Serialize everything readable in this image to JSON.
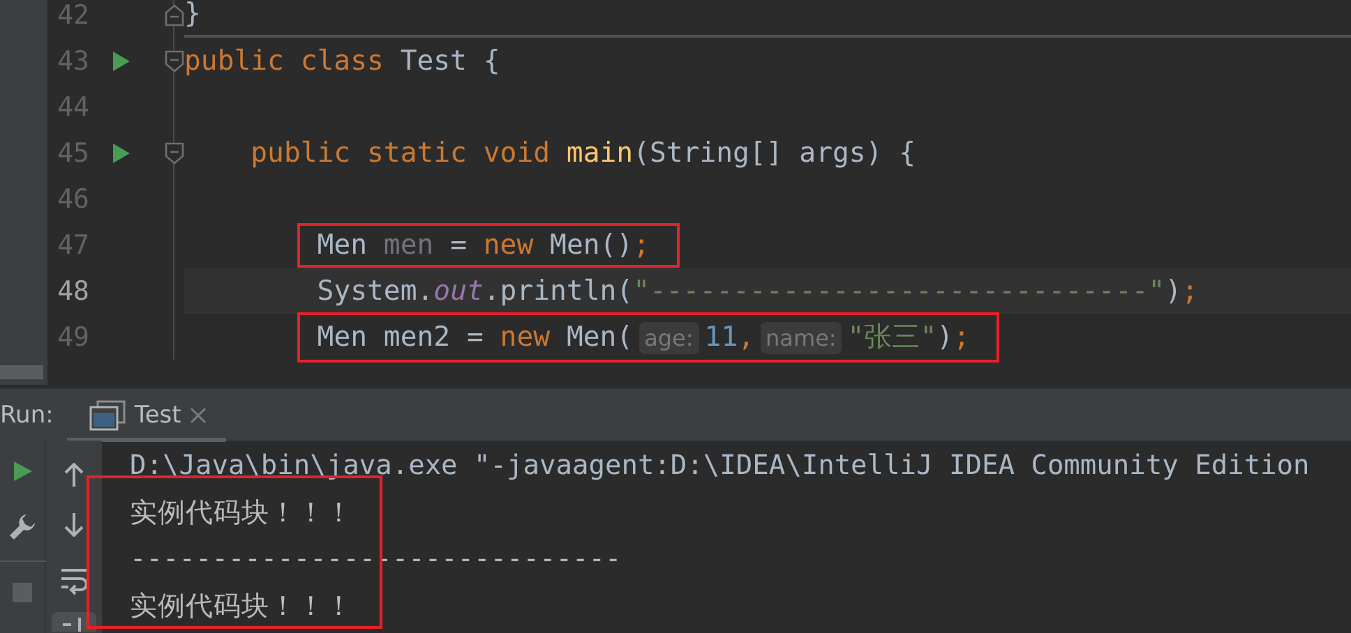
{
  "editor": {
    "lines": [
      {
        "number": "42",
        "current": false,
        "run_icon": false,
        "fold_start": false,
        "fold_end": true,
        "separator": true,
        "annotated": false,
        "tokens": [
          {
            "kind": "plain",
            "text": "}"
          }
        ]
      },
      {
        "number": "43",
        "current": false,
        "run_icon": true,
        "fold_start": true,
        "fold_end": false,
        "separator": false,
        "annotated": false,
        "tokens": [
          {
            "kind": "keyword",
            "text": "public class "
          },
          {
            "kind": "plain",
            "text": "Test {"
          }
        ]
      },
      {
        "number": "44",
        "current": false,
        "run_icon": false,
        "fold_start": false,
        "fold_end": false,
        "separator": false,
        "annotated": false
      },
      {
        "number": "45",
        "current": false,
        "run_icon": true,
        "fold_start": true,
        "fold_end": false,
        "separator": false,
        "annotated": false,
        "tokens": [
          {
            "kind": "keyword",
            "text": "    public static void "
          },
          {
            "kind": "method",
            "text": "main"
          },
          {
            "kind": "plain",
            "text": "(String[] args) {"
          }
        ]
      },
      {
        "number": "46",
        "current": false,
        "run_icon": false,
        "fold_start": false,
        "fold_end": false,
        "separator": false,
        "annotated": false
      },
      {
        "number": "47",
        "current": false,
        "run_icon": false,
        "fold_start": false,
        "fold_end": false,
        "separator": false,
        "annotated": true,
        "tokens": [
          {
            "kind": "plain",
            "text": "        Men "
          },
          {
            "kind": "unused",
            "text": "men"
          },
          {
            "kind": "plain",
            "text": " = "
          },
          {
            "kind": "keyword",
            "text": "new "
          },
          {
            "kind": "plain",
            "text": "Men()"
          },
          {
            "kind": "keyword",
            "text": ";"
          }
        ]
      },
      {
        "number": "48",
        "current": true,
        "run_icon": false,
        "fold_start": false,
        "fold_end": false,
        "separator": false,
        "annotated": false,
        "tokens": [
          {
            "kind": "plain",
            "text": "        System."
          },
          {
            "kind": "static",
            "text": "out"
          },
          {
            "kind": "plain",
            "text": ".println("
          },
          {
            "kind": "string",
            "text": "\"------------------------------\""
          },
          {
            "kind": "plain",
            "text": ")"
          },
          {
            "kind": "keyword",
            "text": ";"
          }
        ]
      },
      {
        "number": "49",
        "current": false,
        "run_icon": false,
        "fold_start": false,
        "fold_end": false,
        "separator": false,
        "annotated": true,
        "tokens": [
          {
            "kind": "plain",
            "text": "        Men men2 = "
          },
          {
            "kind": "keyword",
            "text": "new "
          },
          {
            "kind": "plain",
            "text": "Men("
          },
          {
            "kind": "hint",
            "text": "age:"
          },
          {
            "kind": "number",
            "text": "11"
          },
          {
            "kind": "keyword",
            "text": ","
          },
          {
            "kind": "hint",
            "text": "name:"
          },
          {
            "kind": "string",
            "text": "\"张三\""
          },
          {
            "kind": "plain",
            "text": ")"
          },
          {
            "kind": "keyword",
            "text": ";"
          }
        ]
      }
    ]
  },
  "run_panel": {
    "label": "Run:",
    "tabs": [
      {
        "label": "Test",
        "selected": true
      }
    ]
  },
  "console": {
    "lines": [
      {
        "kind": "command",
        "text": "D:\\Java\\bin\\java.exe \"-javaagent:D:\\IDEA\\IntelliJ IDEA Community Edition",
        "annotated": false
      },
      {
        "kind": "output",
        "text": "实例代码块！！！",
        "annotated": true
      },
      {
        "kind": "output",
        "text": "------------------------------",
        "annotated": true
      },
      {
        "kind": "output",
        "text": "实例代码块！！！",
        "annotated": true
      }
    ]
  }
}
